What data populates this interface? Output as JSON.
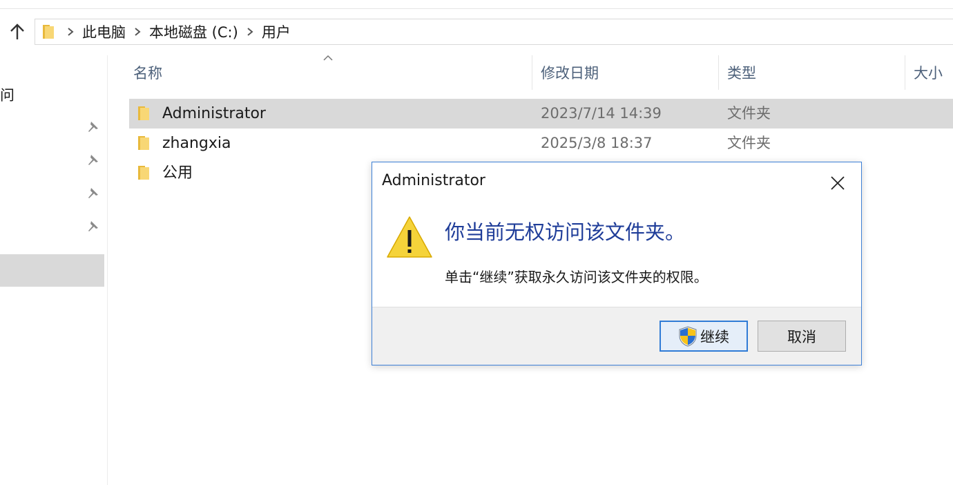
{
  "breadcrumb": {
    "items": [
      "此电脑",
      "本地磁盘 (C:)",
      "用户"
    ]
  },
  "nav": {
    "quick_access_label": "问"
  },
  "columns": {
    "name": "名称",
    "modified": "修改日期",
    "type": "类型",
    "size": "大小"
  },
  "files": [
    {
      "name": "Administrator",
      "modified": "2023/7/14 14:39",
      "type": "文件夹"
    },
    {
      "name": "zhangxia",
      "modified": "2025/3/8 18:37",
      "type": "文件夹"
    },
    {
      "name": "公用",
      "modified": "",
      "type": ""
    }
  ],
  "dialog": {
    "title": "Administrator",
    "message": "你当前无权访问该文件夹。",
    "detail": "单击“继续”获取永久访问该文件夹的权限。",
    "continue_label": "继续",
    "cancel_label": "取消"
  },
  "colors": {
    "accent": "#3c7fd6",
    "message_text": "#1f3d99",
    "selection": "#d9d9d9",
    "folder": "#f2c94c"
  },
  "icons": {
    "up": "arrow-up-icon",
    "folder": "folder-icon",
    "chevron": "chevron-right-icon",
    "pin": "pin-icon",
    "warning": "warning-icon",
    "close": "close-icon",
    "shield": "uac-shield-icon"
  }
}
